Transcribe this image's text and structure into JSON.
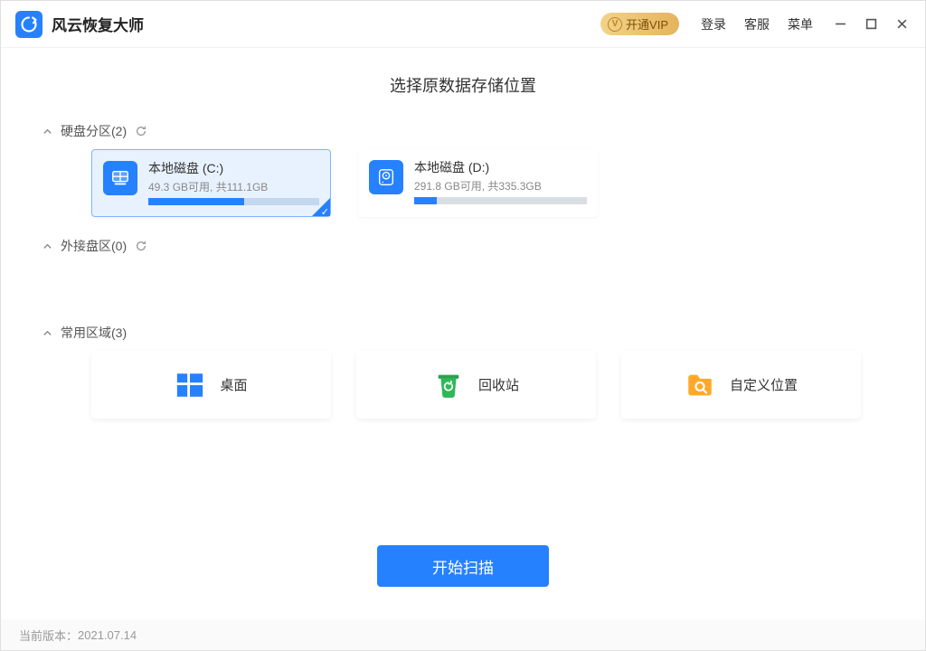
{
  "app": {
    "title": "风云恢复大师"
  },
  "header": {
    "vip_label": "开通VIP",
    "login": "登录",
    "support": "客服",
    "menu": "菜单"
  },
  "main": {
    "page_title": "选择原数据存储位置",
    "sections": {
      "disks": {
        "label": "硬盘分区(2)"
      },
      "external": {
        "label": "外接盘区(0)"
      },
      "areas": {
        "label": "常用区域(3)"
      }
    },
    "disks": [
      {
        "name": "本地磁盘 (C:)",
        "usage": "49.3 GB可用, 共111.1GB",
        "fill_pct": 56,
        "selected": true
      },
      {
        "name": "本地磁盘 (D:)",
        "usage": "291.8 GB可用, 共335.3GB",
        "fill_pct": 13,
        "selected": false
      }
    ],
    "areas": [
      {
        "label": "桌面",
        "icon": "windows"
      },
      {
        "label": "回收站",
        "icon": "recycle"
      },
      {
        "label": "自定义位置",
        "icon": "folder-search"
      }
    ],
    "scan_label": "开始扫描"
  },
  "footer": {
    "version_prefix": "当前版本：",
    "version": "2021.07.14"
  }
}
